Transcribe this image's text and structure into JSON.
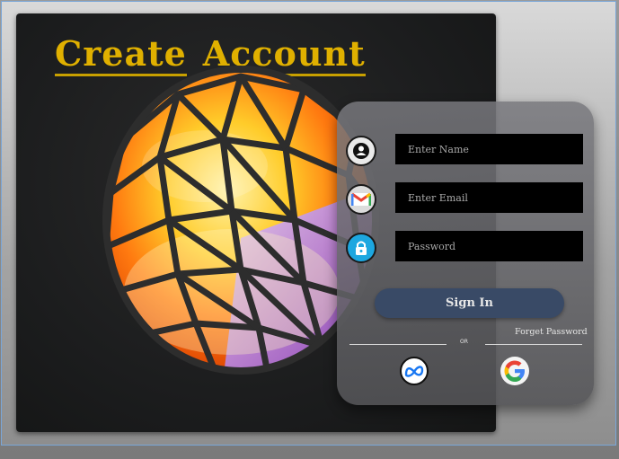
{
  "title": {
    "word1": "Create",
    "word2": "Account"
  },
  "form": {
    "name_placeholder": "Enter Name",
    "email_placeholder": "Enter Email",
    "password_placeholder": "Password",
    "signin_label": "Sign In",
    "forget_label": "Forget Password",
    "or_label": "OR"
  },
  "icons": {
    "name": "user-icon",
    "email": "gmail-icon",
    "password": "lock-icon",
    "social1": "meta-icon",
    "social2": "google-icon"
  },
  "colors": {
    "title": "#e0b000",
    "signin_button": "#394a66",
    "input_bg": "#000000",
    "panel_bg": "#5a5a5d"
  }
}
